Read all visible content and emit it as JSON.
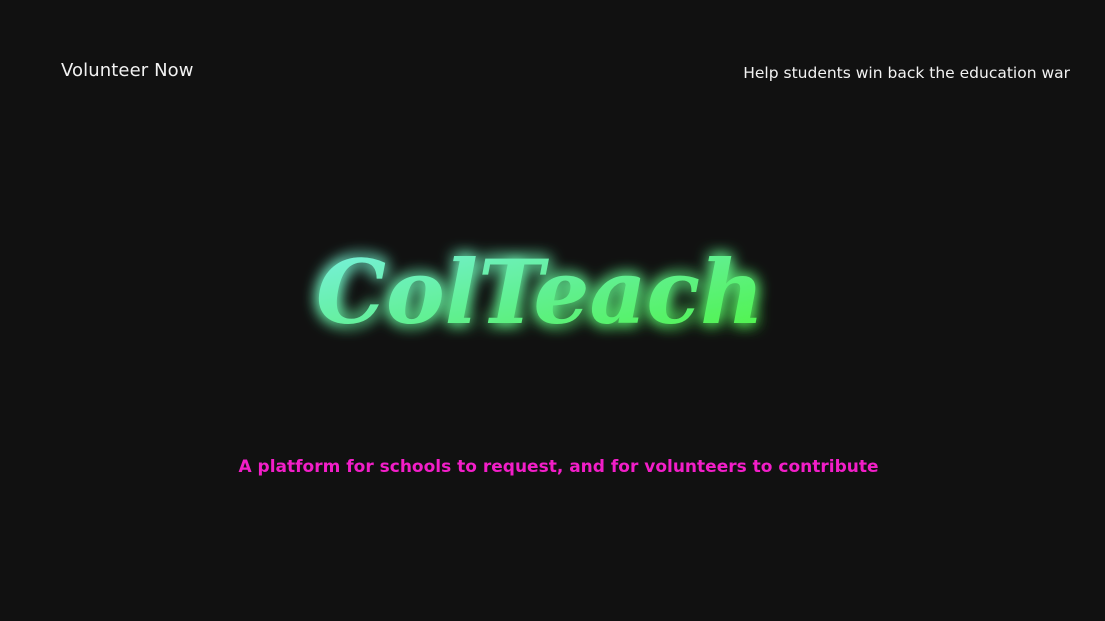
{
  "nav": {
    "volunteer_label": "Volunteer Now",
    "tagline": "Help students win back the education war"
  },
  "hero": {
    "logo_text": "ColTeach",
    "subtitle": "A platform for schools to request,  and for volunteers to contribute"
  },
  "colors": {
    "background": "#111111",
    "logo_gradient_start": "#6ff0d8",
    "logo_gradient_end": "#4ff54a",
    "subtitle": "#f21ec8",
    "nav_text": "#f2f2f2"
  }
}
